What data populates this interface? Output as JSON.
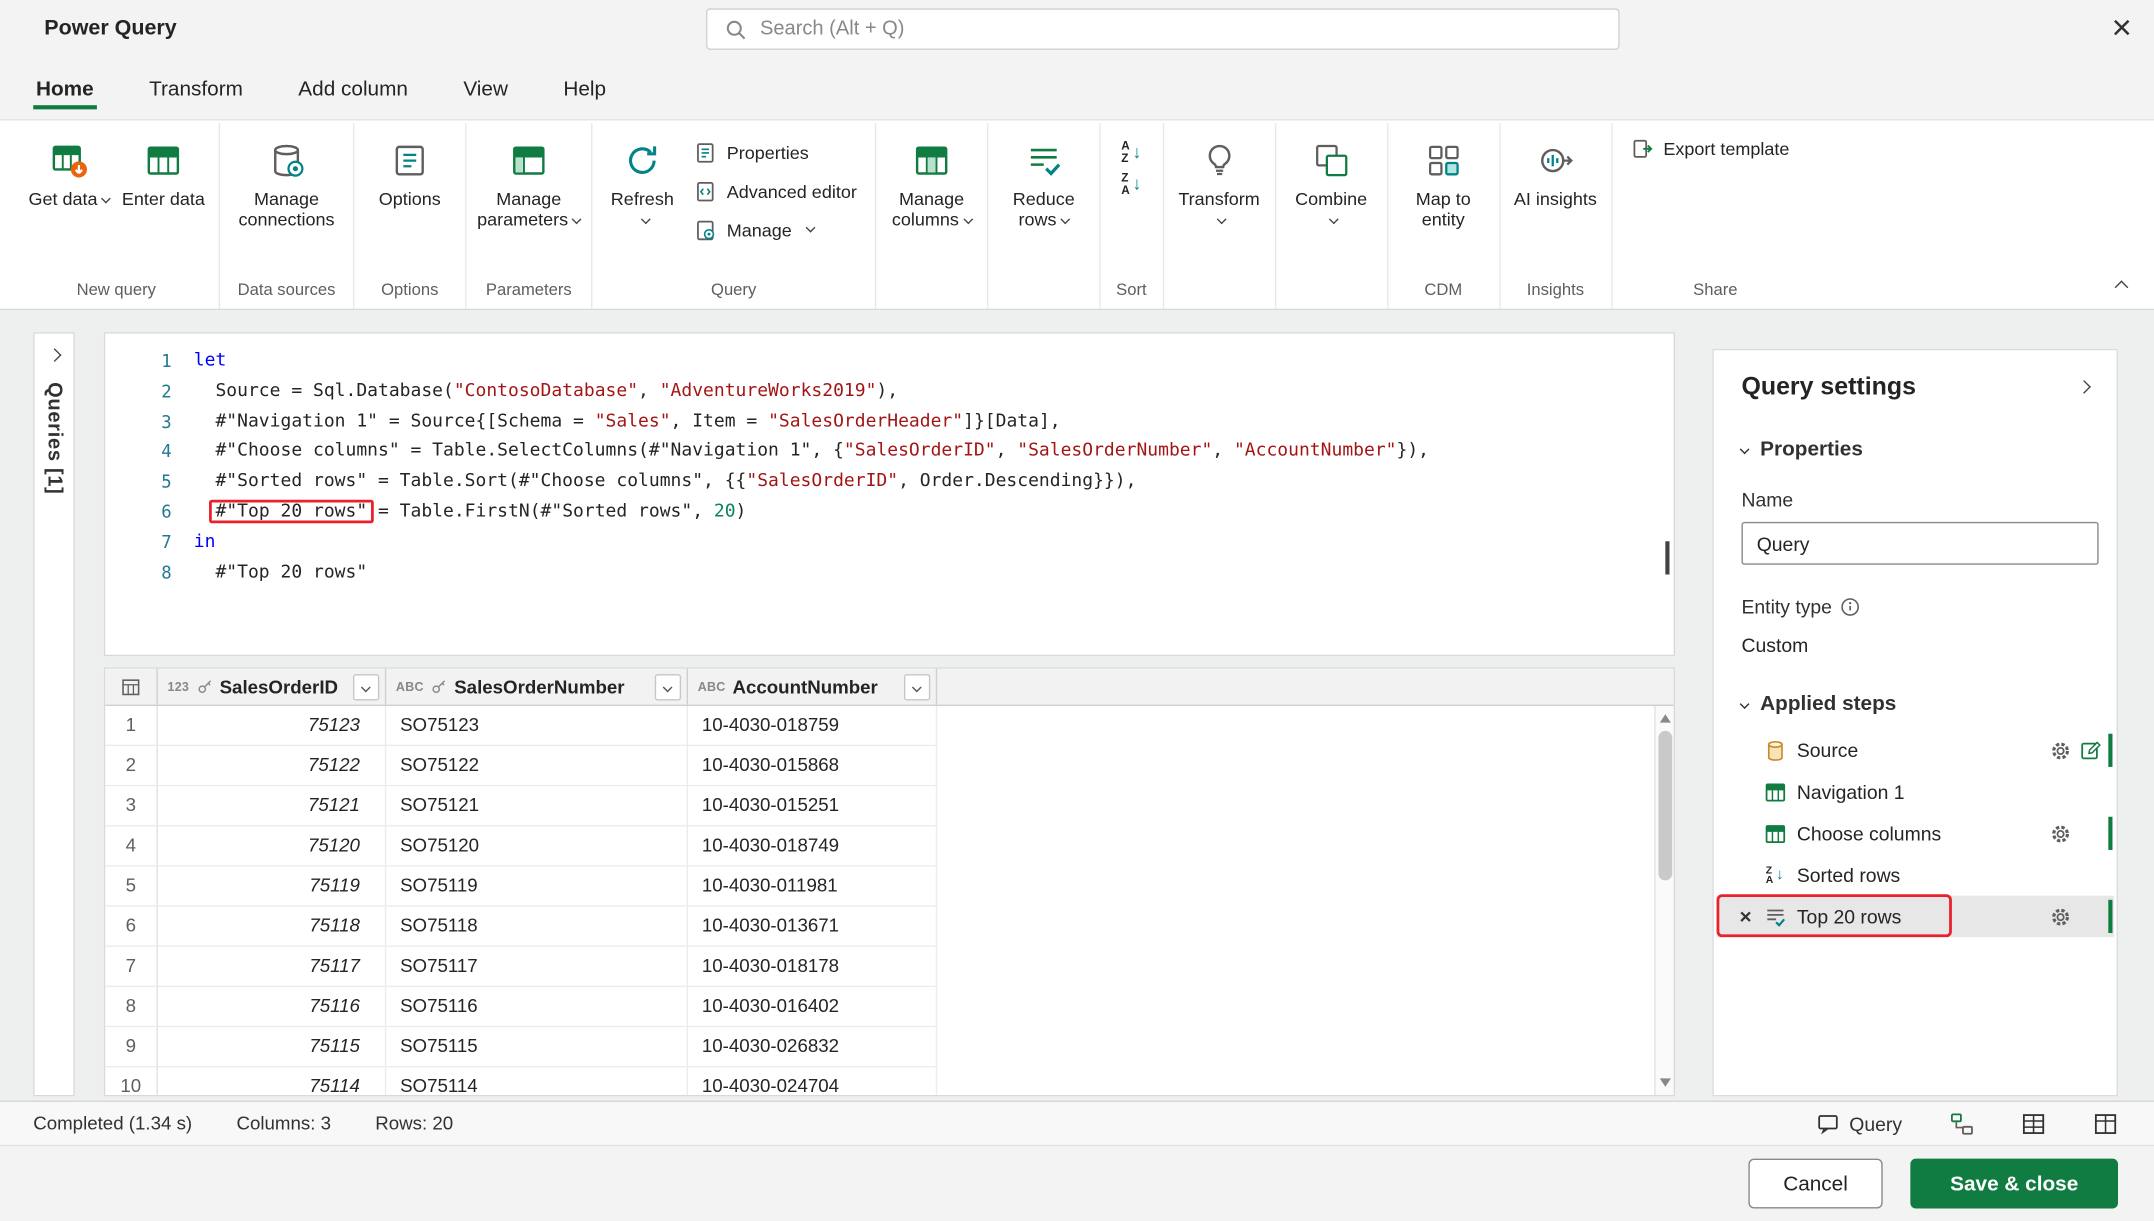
{
  "colors": {
    "accent_green": "#107c41",
    "annotation_red": "#e8212b",
    "teal": "#038387"
  },
  "titlebar": {
    "app_title": "Power Query",
    "search_placeholder": "Search (Alt + Q)",
    "close": "×"
  },
  "tabs": [
    {
      "label": "Home",
      "active": true
    },
    {
      "label": "Transform",
      "active": false
    },
    {
      "label": "Add column",
      "active": false
    },
    {
      "label": "View",
      "active": false
    },
    {
      "label": "Help",
      "active": false
    }
  ],
  "ribbon": {
    "get_data": "Get data",
    "enter_data": "Enter data",
    "manage_connections": "Manage connections",
    "options": "Options",
    "manage_parameters": "Manage parameters",
    "refresh": "Refresh",
    "properties": "Properties",
    "advanced_editor": "Advanced editor",
    "manage": "Manage",
    "manage_columns": "Manage columns",
    "reduce_rows": "Reduce rows",
    "transform": "Transform",
    "combine": "Combine",
    "map_to_entity": "Map to entity",
    "ai_insights": "AI insights",
    "export_template": "Export template",
    "captions": {
      "new_query": "New query",
      "data_sources": "Data sources",
      "options": "Options",
      "parameters": "Parameters",
      "query": "Query",
      "sort": "Sort",
      "cdm": "CDM",
      "insights": "Insights",
      "share": "Share"
    }
  },
  "icons": {
    "sort": {
      "a": "A",
      "z": "Z",
      "arrow": "↓"
    }
  },
  "queries_pane": {
    "label": "Queries [1]"
  },
  "editor": {
    "lines": [
      [
        {
          "t": "let",
          "c": "kw"
        }
      ],
      [
        {
          "t": "  Source = Sql.Database("
        },
        {
          "t": "\"ContosoDatabase\"",
          "c": "str"
        },
        {
          "t": ", "
        },
        {
          "t": "\"AdventureWorks2019\"",
          "c": "str"
        },
        {
          "t": "),"
        }
      ],
      [
        {
          "t": "  #\"Navigation 1\" = Source{[Schema = "
        },
        {
          "t": "\"Sales\"",
          "c": "str"
        },
        {
          "t": ", Item = "
        },
        {
          "t": "\"SalesOrderHeader\"",
          "c": "str"
        },
        {
          "t": "]}[Data],"
        }
      ],
      [
        {
          "t": "  #\"Choose columns\" = Table.SelectColumns(#\"Navigation 1\", {"
        },
        {
          "t": "\"SalesOrderID\"",
          "c": "str"
        },
        {
          "t": ", "
        },
        {
          "t": "\"SalesOrderNumber\"",
          "c": "str"
        },
        {
          "t": ", "
        },
        {
          "t": "\"AccountNumber\"",
          "c": "str"
        },
        {
          "t": "}),"
        }
      ],
      [
        {
          "t": "  #\"Sorted rows\" = Table.Sort(#\"Choose columns\", {{"
        },
        {
          "t": "\"SalesOrderID\"",
          "c": "str"
        },
        {
          "t": ", Order.Descending}}),"
        }
      ],
      [
        {
          "t": "  "
        },
        {
          "t": "#\"Top 20 rows\"",
          "box": true
        },
        {
          "t": " = Table.FirstN(#\"Sorted rows\", "
        },
        {
          "t": "20",
          "c": "num"
        },
        {
          "t": ")"
        }
      ],
      [
        {
          "t": "in",
          "c": "kw"
        }
      ],
      [
        {
          "t": "  #\"Top 20 rows\""
        }
      ]
    ]
  },
  "grid": {
    "columns": [
      {
        "type": "123",
        "key": true,
        "name": "SalesOrderID"
      },
      {
        "type": "ABC",
        "key": true,
        "name": "SalesOrderNumber"
      },
      {
        "type": "ABC",
        "key": false,
        "name": "AccountNumber"
      }
    ],
    "rows": [
      [
        "75123",
        "SO75123",
        "10-4030-018759"
      ],
      [
        "75122",
        "SO75122",
        "10-4030-015868"
      ],
      [
        "75121",
        "SO75121",
        "10-4030-015251"
      ],
      [
        "75120",
        "SO75120",
        "10-4030-018749"
      ],
      [
        "75119",
        "SO75119",
        "10-4030-011981"
      ],
      [
        "75118",
        "SO75118",
        "10-4030-013671"
      ],
      [
        "75117",
        "SO75117",
        "10-4030-018178"
      ],
      [
        "75116",
        "SO75116",
        "10-4030-016402"
      ],
      [
        "75115",
        "SO75115",
        "10-4030-026832"
      ],
      [
        "75114",
        "SO75114",
        "10-4030-024704"
      ]
    ]
  },
  "settings": {
    "title": "Query settings",
    "properties_header": "Properties",
    "name_label": "Name",
    "name_value": "Query",
    "entity_type_label": "Entity type",
    "entity_type_value": "Custom",
    "applied_steps_header": "Applied steps",
    "delete_glyph": "×",
    "steps": [
      {
        "label": "Source",
        "icon": "database-icon",
        "gear": true,
        "edit": true
      },
      {
        "label": "Navigation 1",
        "icon": "table-icon"
      },
      {
        "label": "Choose columns",
        "icon": "table-icon",
        "gear": true
      },
      {
        "label": "Sorted rows",
        "icon": "sort-desc-icon"
      },
      {
        "label": "Top 20 rows",
        "icon": "keep-rows-icon",
        "gear": true,
        "selected": true,
        "deletable": true,
        "annotated": true
      }
    ]
  },
  "statusbar": {
    "status": "Completed (1.34 s)",
    "columns": "Columns: 3",
    "rows": "Rows: 20",
    "query_label": "Query"
  },
  "actions": {
    "cancel": "Cancel",
    "save": "Save & close"
  }
}
